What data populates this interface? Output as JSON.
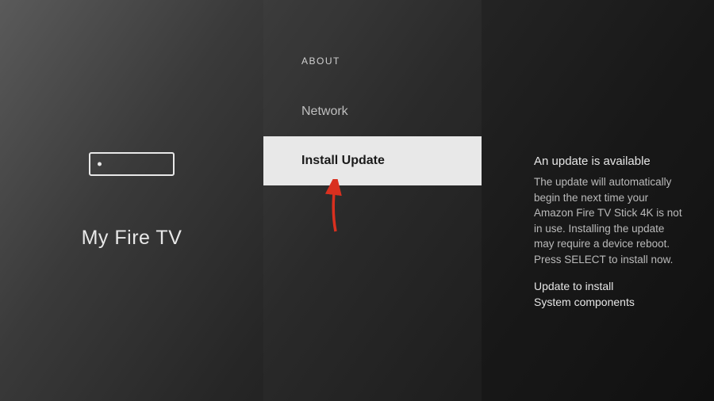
{
  "left": {
    "title": "My Fire TV"
  },
  "middle": {
    "header": "ABOUT",
    "items": [
      {
        "label": "Network",
        "selected": false
      },
      {
        "label": "Install Update",
        "selected": true
      }
    ]
  },
  "right": {
    "title": "An update is available",
    "body": "The update will automatically begin the next time your Amazon Fire TV Stick 4K is not in use. Installing the update may require a device reboot.\nPress SELECT to install now.",
    "sub1": "Update to install",
    "sub2": "System components"
  }
}
